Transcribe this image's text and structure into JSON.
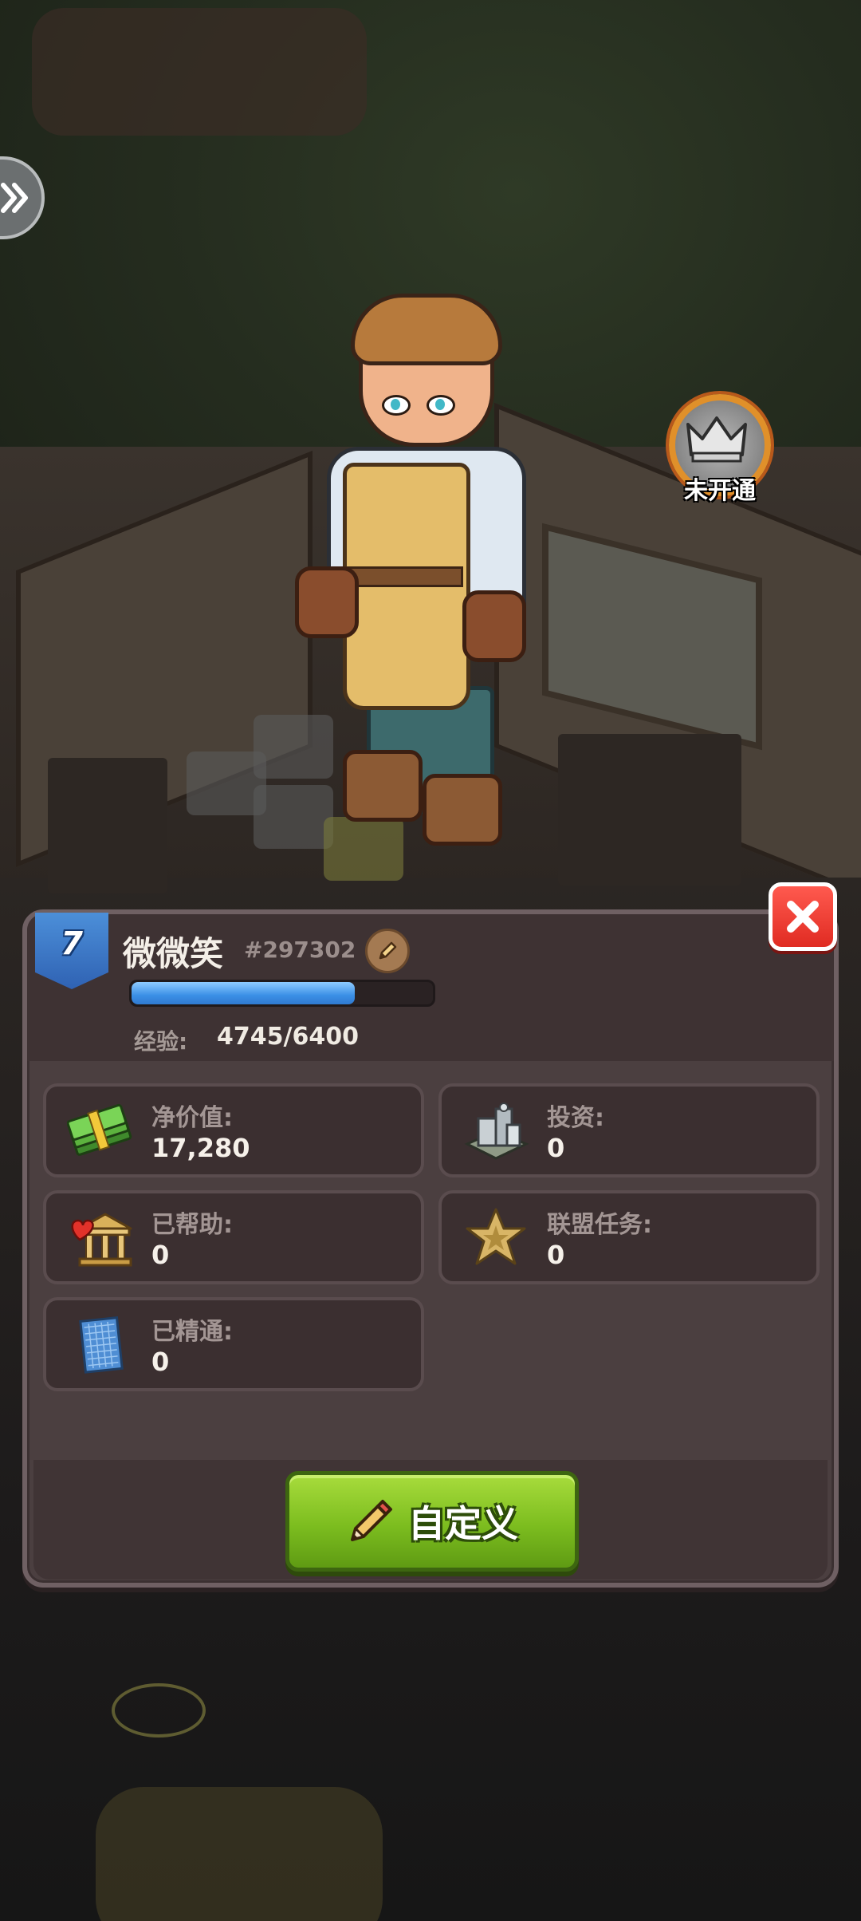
{
  "player": {
    "level": "7",
    "name": "微微笑",
    "id": "#297302",
    "xp_label": "经验:",
    "xp_value": "4745/6400",
    "xp_progress": 0.74
  },
  "crown_badge": {
    "label": "未开通",
    "icon": "crown-icon"
  },
  "stats": {
    "net_worth": {
      "label": "净价值:",
      "value": "17,280",
      "icon": "cash-stack-icon"
    },
    "investment": {
      "label": "投资:",
      "value": "0",
      "icon": "building-icon"
    },
    "helped": {
      "label": "已帮助:",
      "value": "0",
      "icon": "charity-heart-icon"
    },
    "alliance_tasks": {
      "label": "联盟任务:",
      "value": "0",
      "icon": "sheriff-star-icon"
    },
    "mastered": {
      "label": "已精通:",
      "value": "0",
      "icon": "blueprint-icon"
    }
  },
  "buttons": {
    "customize": "自定义",
    "close_icon": "close-icon",
    "edit_icon": "pencil-icon",
    "expand_icon": "double-chevron-icon"
  },
  "colors": {
    "xp_bar": "#3b8fe6",
    "customize_button": "#7cbd1f",
    "close_button": "#e02b22",
    "level_badge": "#2f62b3"
  }
}
